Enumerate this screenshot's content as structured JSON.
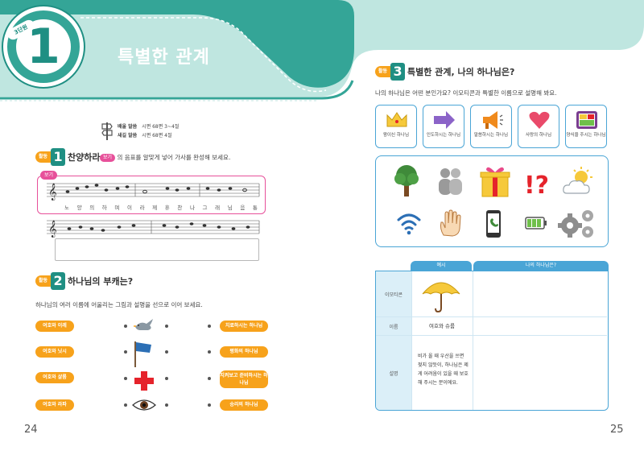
{
  "header": {
    "week_label": "3단원",
    "lesson_number": "1",
    "title": "특별한 관계",
    "colors": {
      "teal": "#34a597",
      "teal_dark": "#1f8f83",
      "orange": "#f7a21b",
      "pink": "#e7509a",
      "blue": "#4aa5d6"
    }
  },
  "scripture": {
    "icon": "signpost-icon",
    "rows": [
      {
        "label": "배울 말씀",
        "ref": "시편 68편 3~4절"
      },
      {
        "label": "새길 말씀",
        "ref": "시편 68편 4절"
      }
    ]
  },
  "activity1": {
    "pill": "활동",
    "number": "1",
    "title": "찬양하라",
    "bogi_inline": "보기",
    "instruction_rest": "의 음표를 알맞게 넣어 가사를 완성해 보세요.",
    "bogi_tag": "보기",
    "lyrics": [
      "노",
      "양",
      "의",
      "하",
      "며",
      "이",
      "라",
      "께",
      "휴",
      "찬",
      "나",
      "그",
      "래",
      "님",
      "음",
      "통"
    ]
  },
  "activity2": {
    "pill": "활동",
    "number": "2",
    "title": "하나님의 부캐는?",
    "instruction": "하나님의 여러 이름에 어울리는 그림과 설명을 선으로 이어 보세요.",
    "left": [
      "여호와 이레",
      "여호와 닛시",
      "여호와 샬롬",
      "여호와 라파"
    ],
    "pictures": [
      "dove-icon",
      "flag-icon",
      "red-cross-icon",
      "eye-icon"
    ],
    "right": [
      "치료하시는 하나님",
      "평화의 하나님",
      "지켜보고 준비하시는 하나님",
      "승리의 하나님"
    ]
  },
  "activity3": {
    "pill": "활동",
    "number": "3",
    "title": "특별한 관계, 나의 하나님은?",
    "instruction": "나의 하나님은 어떤 분인가요? 이모티콘과 특별한 이름으로 설명해 봐요.",
    "cards": [
      {
        "icon": "crown-icon",
        "caption": "왕이신 하나님"
      },
      {
        "icon": "arrow-right-icon",
        "caption": "인도하시는 하나님"
      },
      {
        "icon": "megaphone-icon",
        "caption": "말씀하시는 하나님"
      },
      {
        "icon": "heart-icon",
        "caption": "사랑의 하나님"
      },
      {
        "icon": "lunchbox-icon",
        "caption": "양식을 주시는 하나님"
      }
    ],
    "emoticons": [
      "tree-icon",
      "people-icon",
      "gift-icon",
      "exclaim-question-icon",
      "sun-cloud-icon",
      "wifi-icon",
      "hand-icon",
      "phone-icon",
      "battery-icon",
      "gears-icon"
    ],
    "table": {
      "col_example": "예시",
      "col_mine": "나의 하나님은?",
      "rows": [
        {
          "label": "이모티콘",
          "example_icon": "umbrella-icon"
        },
        {
          "label": "이름",
          "example": "여호와 슈룹"
        },
        {
          "label": "설명",
          "example": "비가 올 때 우산을 쓰면 젖지 않듯이, 하나님은 제게 어려움이 있을 때 보호해 주시는 분이에요."
        }
      ]
    }
  },
  "page_numbers": {
    "left": "24",
    "right": "25"
  }
}
